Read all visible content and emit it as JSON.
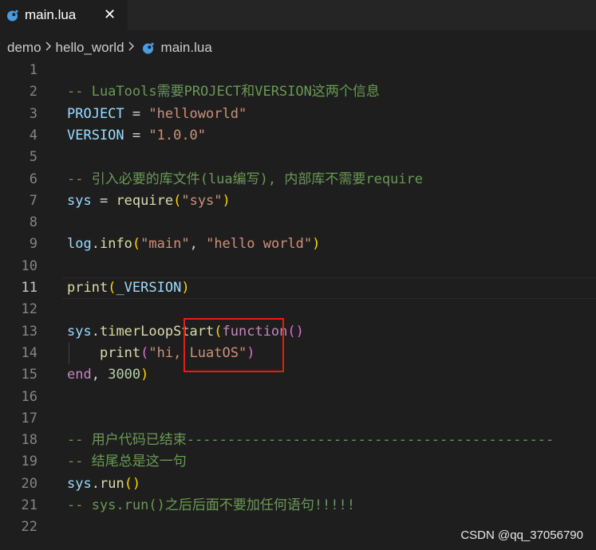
{
  "tab": {
    "label": "main.lua",
    "close": "✕"
  },
  "breadcrumb": {
    "items": [
      "demo",
      "hello_world"
    ],
    "file": "main.lua"
  },
  "colors": {
    "comment": "#6a9955",
    "variable": "#9cdcfe",
    "function": "#dcdcaa",
    "string": "#ce9178",
    "number": "#b5cea8",
    "keyword": "#c586c0",
    "bracket1": "#ffd700",
    "bracket2": "#da70d6",
    "annotation": "#e51c1c"
  },
  "editor": {
    "active_line": 11,
    "lines": [
      {
        "n": "1",
        "tokens": []
      },
      {
        "n": "2",
        "tokens": [
          {
            "t": "cm",
            "v": "-- LuaTools需要PROJECT和VERSION这两个信息"
          }
        ]
      },
      {
        "n": "3",
        "tokens": [
          {
            "t": "var",
            "v": "PROJECT"
          },
          {
            "t": "op",
            "v": " = "
          },
          {
            "t": "str",
            "v": "\"helloworld\""
          }
        ]
      },
      {
        "n": "4",
        "tokens": [
          {
            "t": "var",
            "v": "VERSION"
          },
          {
            "t": "op",
            "v": " = "
          },
          {
            "t": "str",
            "v": "\"1.0.0\""
          }
        ]
      },
      {
        "n": "5",
        "tokens": []
      },
      {
        "n": "6",
        "tokens": [
          {
            "t": "cm",
            "v": "-- 引入必要的库文件(lua编写), 内部库不需要require"
          }
        ]
      },
      {
        "n": "7",
        "tokens": [
          {
            "t": "var",
            "v": "sys"
          },
          {
            "t": "op",
            "v": " = "
          },
          {
            "t": "fn",
            "v": "require"
          },
          {
            "t": "p1",
            "v": "("
          },
          {
            "t": "str",
            "v": "\"sys\""
          },
          {
            "t": "p1",
            "v": ")"
          }
        ]
      },
      {
        "n": "8",
        "tokens": []
      },
      {
        "n": "9",
        "tokens": [
          {
            "t": "var",
            "v": "log"
          },
          {
            "t": "op",
            "v": "."
          },
          {
            "t": "fn",
            "v": "info"
          },
          {
            "t": "p1",
            "v": "("
          },
          {
            "t": "str",
            "v": "\"main\""
          },
          {
            "t": "op",
            "v": ", "
          },
          {
            "t": "str",
            "v": "\"hello world\""
          },
          {
            "t": "p1",
            "v": ")"
          }
        ]
      },
      {
        "n": "10",
        "tokens": []
      },
      {
        "n": "11",
        "tokens": [
          {
            "t": "fn",
            "v": "print"
          },
          {
            "t": "p1",
            "v": "("
          },
          {
            "t": "var",
            "v": "_VERSION"
          },
          {
            "t": "p1",
            "v": ")"
          }
        ]
      },
      {
        "n": "12",
        "tokens": []
      },
      {
        "n": "13",
        "tokens": [
          {
            "t": "var",
            "v": "sys"
          },
          {
            "t": "op",
            "v": "."
          },
          {
            "t": "fn",
            "v": "timerLoopStart"
          },
          {
            "t": "p1",
            "v": "("
          },
          {
            "t": "kw",
            "v": "function"
          },
          {
            "t": "p2",
            "v": "()"
          }
        ]
      },
      {
        "n": "14",
        "tokens": [
          {
            "t": "op",
            "v": "    "
          },
          {
            "t": "fn",
            "v": "print"
          },
          {
            "t": "p2",
            "v": "("
          },
          {
            "t": "str",
            "v": "\"hi, LuatOS\""
          },
          {
            "t": "p2",
            "v": ")"
          }
        ]
      },
      {
        "n": "15",
        "tokens": [
          {
            "t": "kw",
            "v": "end"
          },
          {
            "t": "op",
            "v": ", "
          },
          {
            "t": "num",
            "v": "3000"
          },
          {
            "t": "p1",
            "v": ")"
          }
        ]
      },
      {
        "n": "16",
        "tokens": []
      },
      {
        "n": "17",
        "tokens": []
      },
      {
        "n": "18",
        "tokens": [
          {
            "t": "cm",
            "v": "-- 用户代码已结束---------------------------------------------"
          }
        ]
      },
      {
        "n": "19",
        "tokens": [
          {
            "t": "cm",
            "v": "-- 结尾总是这一句"
          }
        ]
      },
      {
        "n": "20",
        "tokens": [
          {
            "t": "var",
            "v": "sys"
          },
          {
            "t": "op",
            "v": "."
          },
          {
            "t": "fn",
            "v": "run"
          },
          {
            "t": "p1",
            "v": "()"
          }
        ]
      },
      {
        "n": "21",
        "tokens": [
          {
            "t": "cm",
            "v": "-- sys.run()之后后面不要加任何语句!!!!!"
          }
        ]
      },
      {
        "n": "22",
        "tokens": []
      }
    ]
  },
  "watermark": "CSDN @qq_37056790"
}
